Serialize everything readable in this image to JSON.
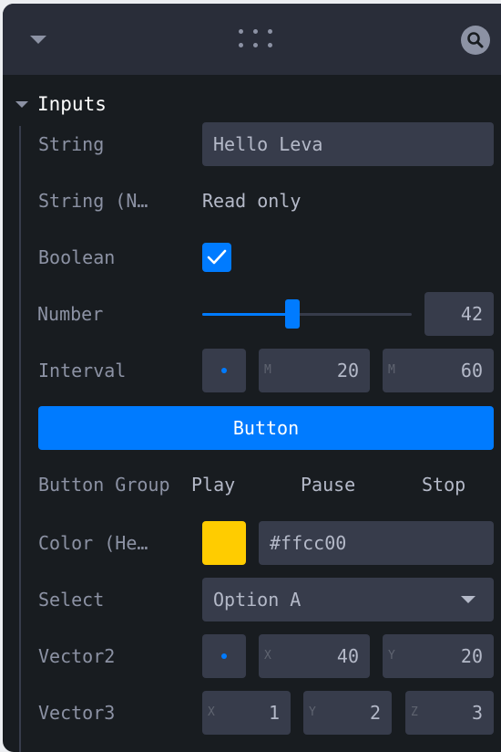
{
  "folder": {
    "title": "Inputs"
  },
  "rows": {
    "string": {
      "label": "String",
      "value": "Hello Leva"
    },
    "string_readonly": {
      "label": "String (N…",
      "value": "Read only"
    },
    "boolean": {
      "label": "Boolean",
      "checked": true
    },
    "number": {
      "label": "Number",
      "value": "42",
      "slider_fraction": 0.43
    },
    "interval": {
      "label": "Interval",
      "min_letter": "M",
      "min": "20",
      "max_letter": "M",
      "max": "60"
    },
    "button": {
      "label": "Button"
    },
    "button_group": {
      "label": "Button Group",
      "buttons": [
        "Play",
        "Pause",
        "Stop"
      ]
    },
    "color": {
      "label": "Color (He…",
      "value": "#ffcc00",
      "swatch": "#ffcc00"
    },
    "select": {
      "label": "Select",
      "value": "Option A"
    },
    "vector2": {
      "label": "Vector2",
      "x_letter": "X",
      "x": "40",
      "y_letter": "Y",
      "y": "20"
    },
    "vector3": {
      "label": "Vector3",
      "x_letter": "X",
      "x": "1",
      "y_letter": "Y",
      "y": "2",
      "z_letter": "Z",
      "z": "3"
    }
  },
  "icons": {
    "collapse": "caret-down-icon",
    "drag": "drag-handle-icon",
    "search": "search-icon"
  },
  "colors": {
    "accent": "#007bff",
    "panel_bg": "#181c20",
    "field_bg": "#373c4b"
  }
}
